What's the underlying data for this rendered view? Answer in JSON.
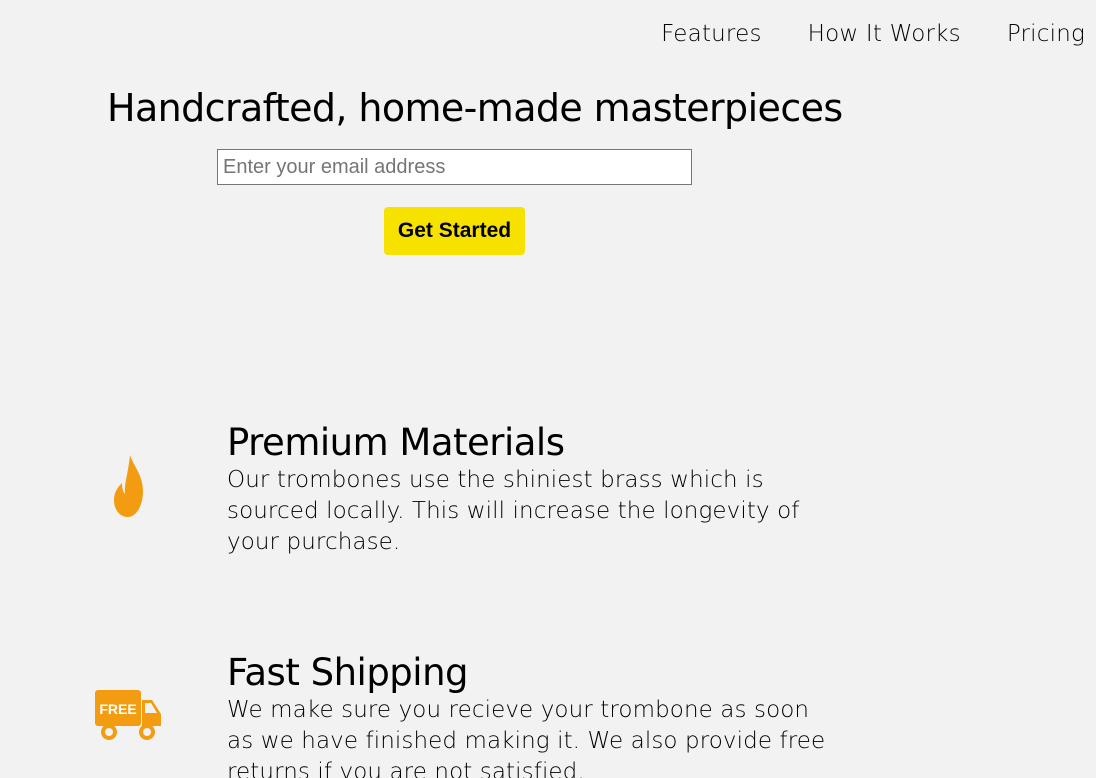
{
  "nav": {
    "items": [
      {
        "label": "Features"
      },
      {
        "label": "How It Works"
      },
      {
        "label": "Pricing"
      }
    ]
  },
  "hero": {
    "title": "Handcrafted, home-made masterpieces",
    "email_placeholder": "Enter your email address",
    "email_value": "",
    "cta_label": "Get Started"
  },
  "features": [
    {
      "icon": "flame-icon",
      "title": "Premium Materials",
      "description": "Our trombones use the shiniest brass which is sourced locally. This will increase the longevity of your purchase."
    },
    {
      "icon": "truck-icon",
      "icon_text": "FREE",
      "title": "Fast Shipping",
      "description": "We make sure you recieve your trombone as soon as we have finished making it. We also provide free returns if you are not satisfied."
    }
  ],
  "colors": {
    "background": "#f2f2f2",
    "button": "#f7e100",
    "icon_orange": "#f39c12"
  }
}
